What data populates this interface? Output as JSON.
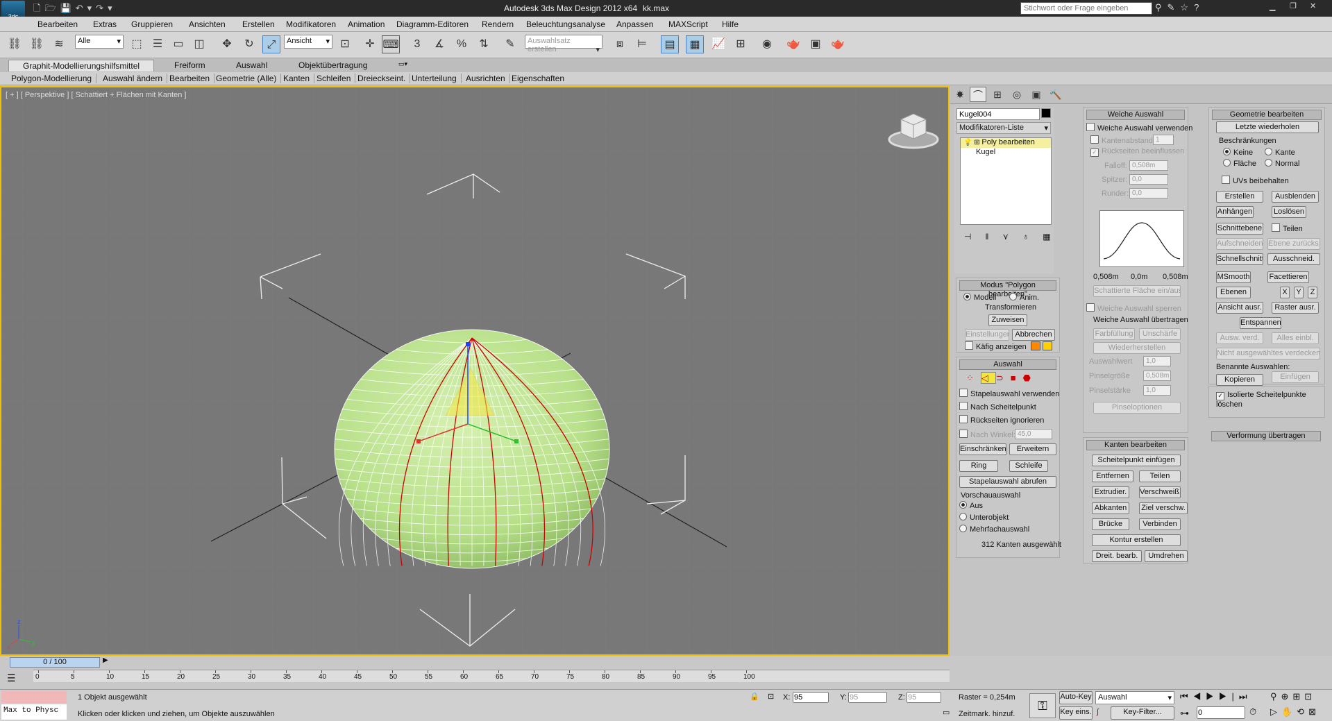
{
  "window": {
    "title": "Autodesk 3ds Max Design 2012 x64",
    "file": "kk.max",
    "search_placeholder": "Stichwort oder Frage eingeben"
  },
  "menu": [
    "Bearbeiten",
    "Extras",
    "Gruppieren",
    "Ansichten",
    "Erstellen",
    "Modifikatoren",
    "Animation",
    "Diagramm-Editoren",
    "Rendern",
    "Beleuchtungsanalyse",
    "Anpassen",
    "MAXScript",
    "Hilfe"
  ],
  "toolbar": {
    "filter": "Alle",
    "refcoord": "Ansicht",
    "selset_placeholder": "Auswahlsatz erstellen"
  },
  "ribbon": {
    "tabs": [
      "Graphit-Modellierungshilfsmittel",
      "Freiform",
      "Auswahl",
      "Objektübertragung"
    ],
    "subtabs": [
      "Polygon-Modellierung",
      "Auswahl ändern",
      "Bearbeiten",
      "Geometrie (Alle)",
      "Kanten",
      "Schleifen",
      "Dreieckseint.",
      "Unterteilung",
      "Ausrichten",
      "Eigenschaften"
    ]
  },
  "viewport": {
    "label": "[ + ] [ Perspektive ] [ Schattiert + Flächen mit Kanten ]",
    "colors": {
      "sphere": "#b8e08a",
      "edge_sel": "#cc0000",
      "border": "#f0c000"
    }
  },
  "modify": {
    "object_name": "Kugel004",
    "modlist": "Modifikatoren-Liste",
    "stack": [
      "Poly bearbeiten",
      "Kugel"
    ],
    "mode": {
      "title": "Modus \"Polygon bearbeiten\"",
      "modell": "Modell",
      "anim": "Anim.",
      "transform": "Transformieren",
      "zuweisen": "Zuweisen",
      "einstellungen": "Einstellungen",
      "abbrechen": "Abbrechen",
      "kaefig": "Käfig anzeigen"
    },
    "selection": {
      "title": "Auswahl",
      "stapel": "Stapelauswahl verwenden",
      "nach": "Nach Scheitelpunkt",
      "rueck": "Rückseiten ignorieren",
      "winkel": "Nach Winkel:",
      "winkel_val": "45,0",
      "einschr": "Einschränken",
      "erweit": "Erweitern",
      "ring": "Ring",
      "schleife": "Schleife",
      "abrufen": "Stapelauswahl abrufen",
      "vorschau": "Vorschauauswahl",
      "aus": "Aus",
      "unterobj": "Unterobjekt",
      "mehrfach": "Mehrfachauswahl",
      "count": "312 Kanten ausgewählt"
    }
  },
  "soft": {
    "title": "Weiche Auswahl",
    "use": "Weiche Auswahl verwenden",
    "kantenabst": "Kantenabstand:",
    "kantenabst_val": "1",
    "rueck": "Rückseiten beeinflussen",
    "falloff": "Falloff:",
    "falloff_val": "0,508m",
    "spitzer": "Spitzer:",
    "spitzer_val": "0,0",
    "runder": "Runder:",
    "runder_val": "0,0",
    "curve_labels": [
      "0,508m",
      "0,0m",
      "0,508m"
    ],
    "schatt": "Schattierte Fläche ein/aus",
    "sperren": "Weiche Auswahl sperren",
    "uebertr": "Weiche Auswahl übertragen",
    "farb": "Farbfüllung",
    "unsch": "Unschärfe",
    "wieder": "Wiederherstellen",
    "auswahlwert": "Auswahlwert",
    "auswahlwert_val": "1,0",
    "pinselgr": "Pinselgröße",
    "pinselgr_val": "0,508m",
    "pinselst": "Pinselstärke",
    "pinselst_val": "1,0",
    "pinselopt": "Pinseloptionen"
  },
  "edges": {
    "title": "Kanten bearbeiten",
    "einf": "Scheitelpunkt einfügen",
    "entf": "Entfernen",
    "teilen": "Teilen",
    "extr": "Extrudier.",
    "versch": "Verschweiß.",
    "abkant": "Abkanten",
    "ziel": "Ziel verschw.",
    "bruecke": "Brücke",
    "verbinden": "Verbinden",
    "kontur": "Kontur erstellen",
    "dreit": "Dreit. bearb.",
    "umdrehen": "Umdrehen"
  },
  "geom": {
    "title": "Geometrie bearbeiten",
    "letzte": "Letzte wiederholen",
    "beschr": "Beschränkungen",
    "keine": "Keine",
    "kante": "Kante",
    "flaeche": "Fläche",
    "normal": "Normal",
    "uvs": "UVs beibehalten",
    "erstellen": "Erstellen",
    "ausblenden": "Ausblenden",
    "anhaengen": "Anhängen",
    "loesen": "Loslösen",
    "schnitt": "Schnittebene",
    "teilen": "Teilen",
    "aufschn": "Aufschneiden",
    "ebene": "Ebene zurücks.",
    "schnell": "Schnellschnitt",
    "aussch": "Ausschneid.",
    "msmooth": "MSmooth",
    "facett": "Facettieren",
    "ebnen": "Ebenen",
    "x": "X",
    "y": "Y",
    "z": "Z",
    "ansicht": "Ansicht ausr.",
    "raster": "Raster ausr.",
    "entspannen": "Entspannen",
    "ausw": "Ausw. verd.",
    "alles": "Alles einbl.",
    "nicht": "Nicht ausgewähltes verdecken",
    "benannte": "Benannte Auswahlen:",
    "kopieren": "Kopieren",
    "einfuegen": "Einfügen",
    "isol": "Isolierte Scheitelpunkte löschen",
    "verform": "Verformung übertragen"
  },
  "timeline": {
    "frame": "0 / 100",
    "ticks": [
      "0",
      "5",
      "10",
      "15",
      "20",
      "25",
      "30",
      "35",
      "40",
      "45",
      "50",
      "55",
      "60",
      "65",
      "70",
      "75",
      "80",
      "85",
      "90",
      "95",
      "100"
    ]
  },
  "status": {
    "script": "Max to Physc",
    "sel": "1 Objekt ausgewählt",
    "prompt": "Klicken oder klicken und ziehen, um Objekte auszuwählen",
    "x_label": "X:",
    "x": "95",
    "y_label": "Y:",
    "y": "95",
    "z_label": "Z:",
    "z": "95",
    "raster": "Raster = 0,254m",
    "zeitmark": "Zeitmark. hinzuf.",
    "autokey": "Auto-Key",
    "keymode": "Auswahl",
    "keyeins": "Key eins.",
    "keyfilter": "Key-Filter...",
    "frame_val": "0"
  }
}
